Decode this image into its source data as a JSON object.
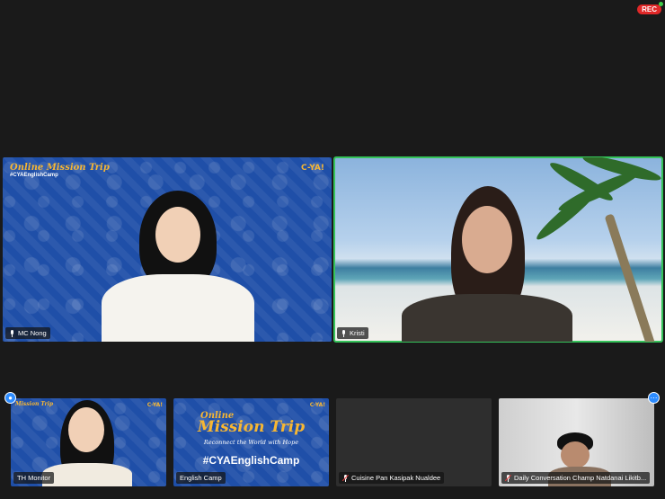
{
  "recording": {
    "label": "REC",
    "color": "#e02828"
  },
  "main_tiles": [
    {
      "name": "MC Nong",
      "muted": false,
      "active": false,
      "brand_line1": "Online Mission Trip",
      "brand_line2": "#CYAEnglishCamp",
      "brand_right": "C-YA!"
    },
    {
      "name": "Kristi",
      "muted": false,
      "active": true
    }
  ],
  "small_tiles": [
    {
      "name": "TH Monitor",
      "muted": false,
      "brand_line1": "Mission Trip",
      "brand_right": "C-YA!"
    },
    {
      "name": "English Camp",
      "muted": false,
      "mission_online": "Online",
      "mission_title": "Mission Trip",
      "mission_sub": "Reconnect the World with Hope",
      "mission_hashtag": "#CYAEnglishCamp",
      "brand_right": "C-YA!"
    },
    {
      "name": "Cuisine Pan Kasipak Nualdee",
      "muted": true
    },
    {
      "name": "Daily Conversation Champ Natdanai Likitb...",
      "muted": true
    }
  ],
  "icons": {
    "rec_status": "green-dot",
    "pin": "person-pin-icon",
    "more": "more-icon"
  },
  "colors": {
    "active_speaker": "#35c35a",
    "brand_blue": "#1f4fa8",
    "brand_yellow": "#f7b733"
  }
}
